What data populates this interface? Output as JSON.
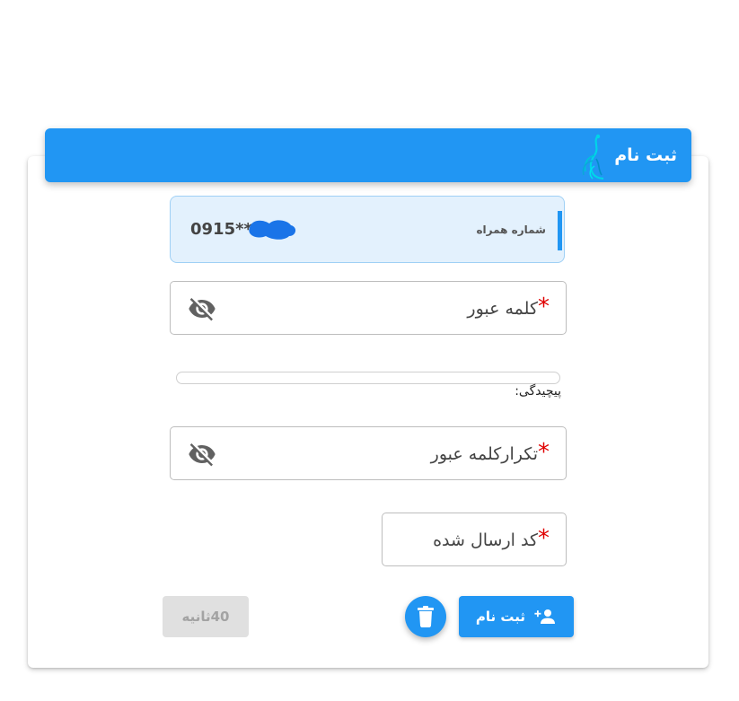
{
  "header": {
    "title": "ثبت نام"
  },
  "phone": {
    "label": "شماره همراه",
    "value": "0915***"
  },
  "password": {
    "label": "کلمه عبور",
    "required_mark": "*"
  },
  "complexity": {
    "label": "پیچیدگی:",
    "level": 0
  },
  "confirm_password": {
    "label": "تکرارکلمه عبور",
    "required_mark": "*"
  },
  "code": {
    "label": "کد ارسال شده",
    "required_mark": "*"
  },
  "buttons": {
    "register": "ثبت نام",
    "timer": "40ثانیه"
  },
  "colors": {
    "primary": "#2196f3",
    "required": "#e00000",
    "disabled": "#e0e0e0"
  },
  "icons": {
    "logo": "peacock-logo-icon",
    "eye": "eye-off-icon",
    "register": "person-add-icon",
    "delete": "trash-icon"
  }
}
